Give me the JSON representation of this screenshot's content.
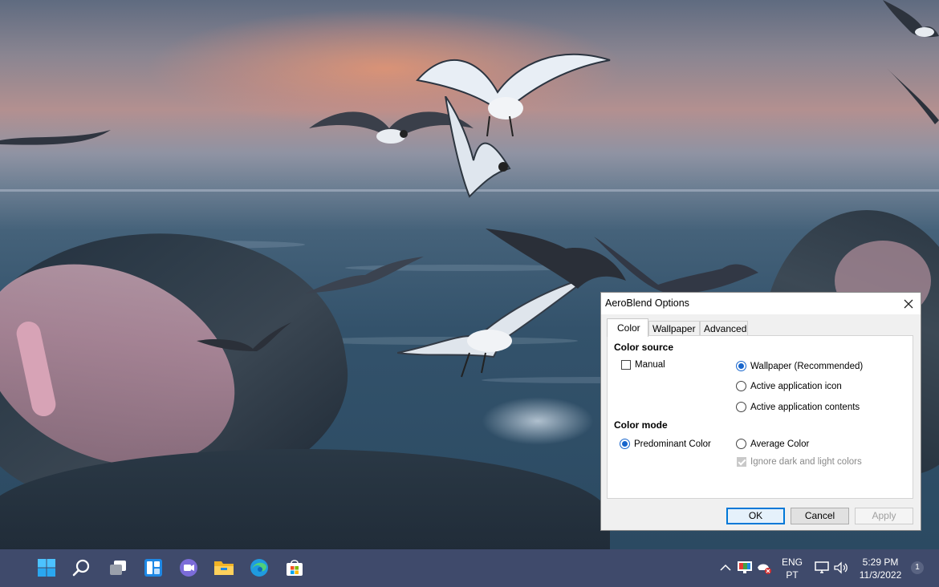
{
  "dialog": {
    "title": "AeroBlend Options",
    "tabs": [
      {
        "label": "Color",
        "active": true
      },
      {
        "label": "Wallpaper",
        "active": false
      },
      {
        "label": "Advanced",
        "active": false
      }
    ],
    "color_source": {
      "heading": "Color source",
      "manual": {
        "label": "Manual",
        "checked": false
      },
      "options": [
        {
          "label": "Wallpaper (Recommended)",
          "checked": true
        },
        {
          "label": "Active application icon",
          "checked": false
        },
        {
          "label": "Active application contents",
          "checked": false
        }
      ]
    },
    "color_mode": {
      "heading": "Color mode",
      "options": [
        {
          "label": "Predominant Color",
          "checked": true
        },
        {
          "label": "Average Color",
          "checked": false
        }
      ],
      "ignore": {
        "label": "Ignore dark and light colors",
        "checked": true,
        "disabled": true
      }
    },
    "buttons": {
      "ok": "OK",
      "cancel": "Cancel",
      "apply": "Apply"
    },
    "accent_color": "#1765cc"
  },
  "taskbar": {
    "icons": [
      "windows-start-icon",
      "search-icon",
      "task-view-icon",
      "widgets-icon",
      "teams-chat-icon",
      "file-explorer-icon",
      "edge-icon",
      "microsoft-store-icon"
    ],
    "tray": {
      "language_top": "ENG",
      "language_bottom": "PT",
      "time": "5:29 PM",
      "date": "11/3/2022",
      "notifications": "1"
    },
    "background": "#3f4a6b"
  }
}
